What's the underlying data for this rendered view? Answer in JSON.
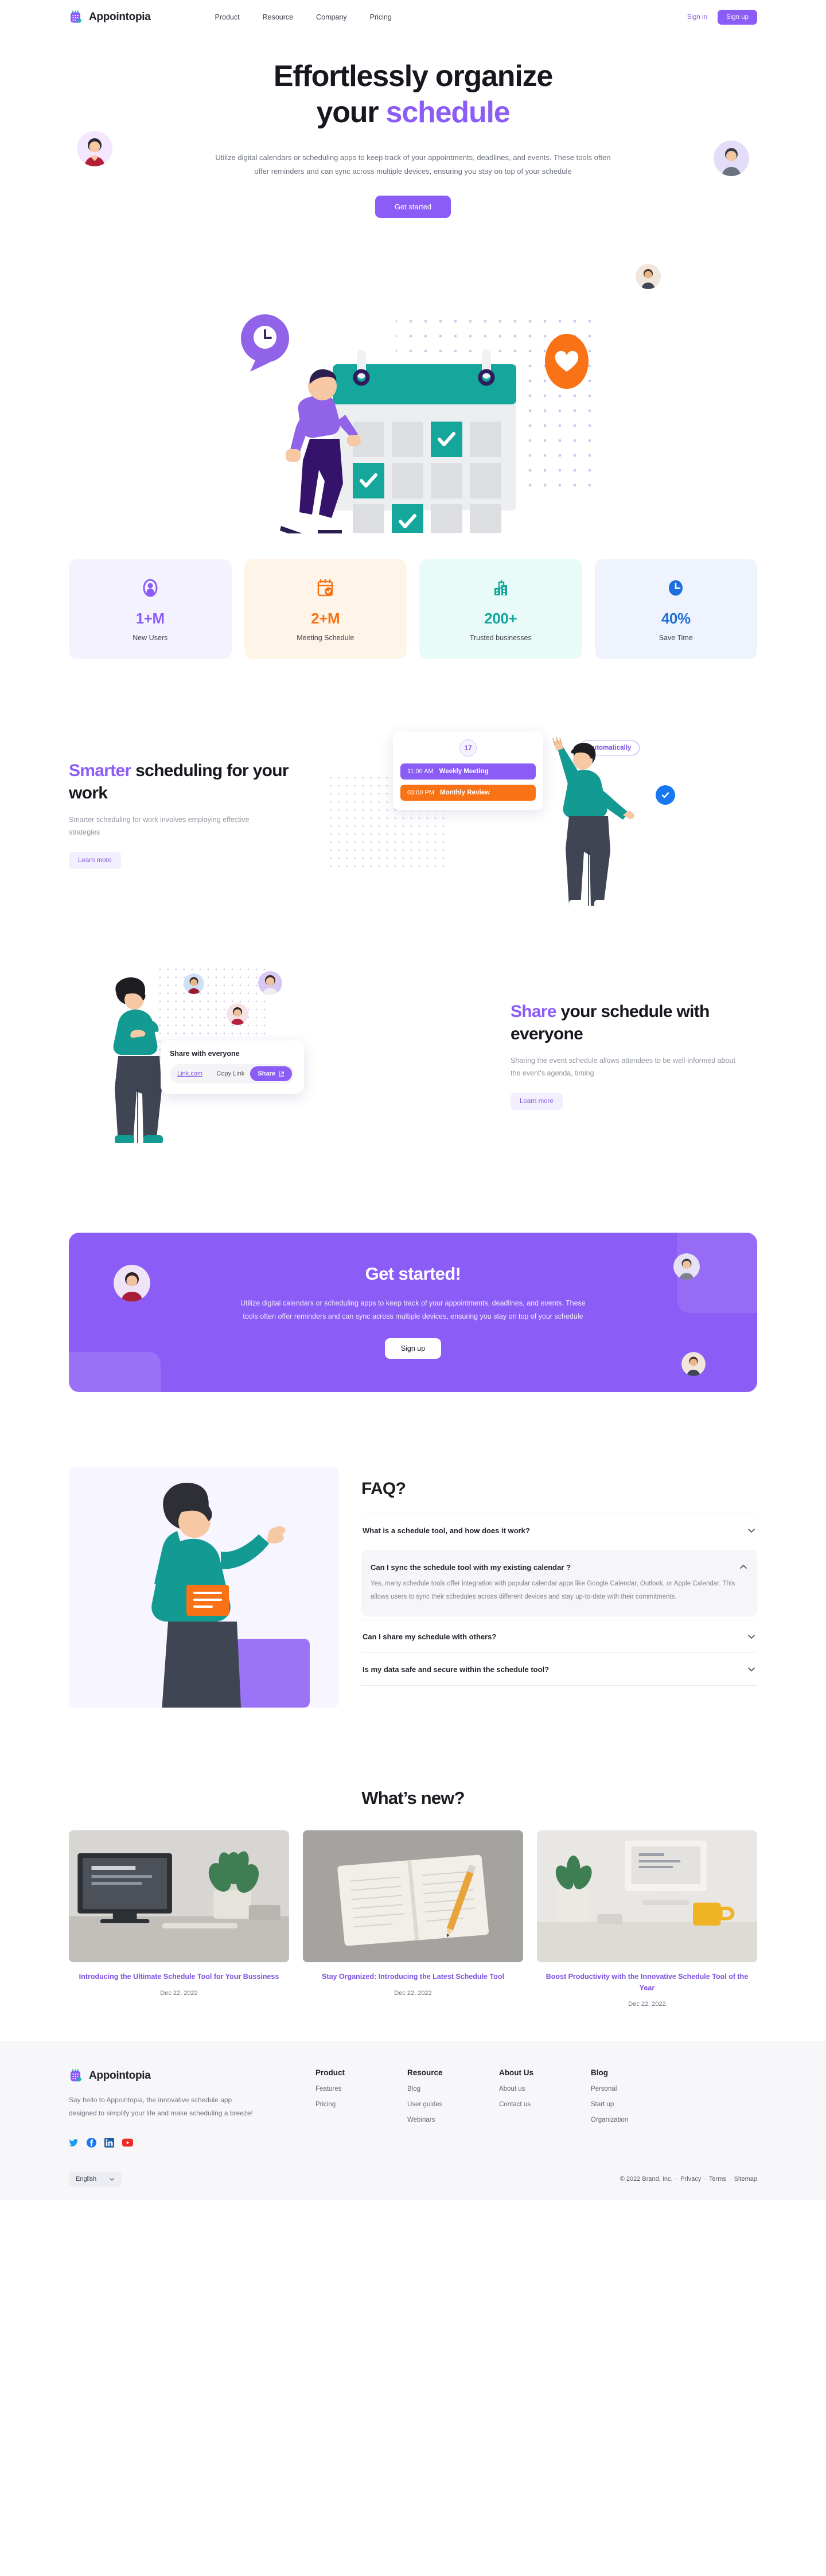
{
  "brand": {
    "name": "Appointopia",
    "logo_icon": "calendar-logo-icon"
  },
  "nav": {
    "links": [
      {
        "label": "Product"
      },
      {
        "label": "Resource"
      },
      {
        "label": "Company"
      },
      {
        "label": "Pricing"
      }
    ],
    "sign_in": "Sign in",
    "sign_up": "Sign up"
  },
  "hero": {
    "title_line1": "Effortlessly organize",
    "title_line2_plain": "your ",
    "title_line2_accent": "schedule",
    "subtitle": "Utilize digital calendars or scheduling apps to keep track of your appointments, deadlines, and events. These tools often offer reminders and can sync across multiple devices, ensuring you stay on top of your schedule",
    "cta_label": "Get started"
  },
  "stats": [
    {
      "icon": "user-avatar-icon",
      "value": "1+M",
      "label": "New Users",
      "bg": "#f5f2ff",
      "color": "#8b5cf6"
    },
    {
      "icon": "calendar-check-icon",
      "value": "2+M",
      "label": "Meeting Schedule",
      "bg": "#fff4e8",
      "color": "#f97316"
    },
    {
      "icon": "office-building-icon",
      "value": "200+",
      "label": "Trusted businesses",
      "bg": "#e9fbf8",
      "color": "#14a89d"
    },
    {
      "icon": "clock-icon",
      "value": "40%",
      "label": "Save Time",
      "bg": "#eef3fd",
      "color": "#1e6fd9"
    }
  ],
  "smarter": {
    "title_accent": "Smarter",
    "title_rest": " scheduling for your work",
    "body": "Smarter scheduling for work involves employing effective strategies",
    "cta_label": "Learn more",
    "card": {
      "day": "17",
      "events": [
        {
          "time": "11:00 AM",
          "title": "Weekly Meeting",
          "color": "#8b5cf6"
        },
        {
          "time": "03:00 PM",
          "title": "Monthly Review",
          "color": "#f97316"
        }
      ],
      "badge": "Automatically"
    }
  },
  "share": {
    "title_accent": "Share",
    "title_rest": " your schedule with everyone",
    "body": "Sharing the event schedule allows attendees to be well-informed about the event's agenda, timing",
    "cta_label": "Learn more",
    "card": {
      "heading": "Share with everyone",
      "link": "Link.com",
      "copy_label": "Copy Link",
      "share_label": "Share"
    }
  },
  "cta": {
    "title": "Get started!",
    "body": "Utilize digital calendars or scheduling apps to keep track of your appointments, deadlines, and events. These tools often offer reminders and can sync across multiple devices, ensuring you stay on top of your schedule",
    "button": "Sign up"
  },
  "faq": {
    "heading": "FAQ?",
    "items": [
      {
        "question": "What is a schedule tool, and how does it work?",
        "answer": "",
        "open": false
      },
      {
        "question": "Can I sync the schedule tool with my existing calendar ?",
        "answer": "Yes, many schedule tools offer integration with popular calendar apps like Google Calendar, Outlook, or Apple Calendar. This allows users to sync their schedules across different devices and stay up-to-date with their commitments.",
        "open": true
      },
      {
        "question": "Can I share my schedule with others?",
        "answer": "",
        "open": false
      },
      {
        "question": "Is my data safe and secure within the schedule tool?",
        "answer": "",
        "open": false
      }
    ]
  },
  "whats_new": {
    "heading": "What’s new?",
    "posts": [
      {
        "title": "Introducing the Ultimate Schedule Tool for Your Bussiness",
        "date": "Dec 22, 2022",
        "thumb": "desk-monitor-plant-photo"
      },
      {
        "title": "Stay Organized: Introducing the Latest Schedule Tool",
        "date": "Dec 22, 2022",
        "thumb": "open-notebook-pencil-photo"
      },
      {
        "title": "Boost Productivity with the Innovative Schedule Tool of the Year",
        "date": "Dec 22, 2022",
        "thumb": "white-desk-mug-photo"
      }
    ]
  },
  "footer": {
    "brand": "Appointopia",
    "description": "Say hello to Appointopia, the innovative schedule app designed to simplify your life and make scheduling a breeze!",
    "socials": [
      {
        "name": "twitter-icon",
        "color": "#1d9bf0"
      },
      {
        "name": "facebook-icon",
        "color": "#1877f2"
      },
      {
        "name": "linkedin-icon",
        "color": "#1d5fa8"
      },
      {
        "name": "youtube-icon",
        "color": "#ed2a26"
      }
    ],
    "columns": [
      {
        "heading": "Product",
        "links": [
          "Features",
          "Pricing"
        ]
      },
      {
        "heading": "Resource",
        "links": [
          "Blog",
          "User guides",
          "Webinars"
        ]
      },
      {
        "heading": "About Us",
        "links": [
          "About us",
          "Contact us"
        ]
      },
      {
        "heading": "Blog",
        "links": [
          "Personal",
          "Start up",
          "Organization"
        ]
      }
    ],
    "language": "English",
    "copyright": "© 2022 Brand, Inc.",
    "legal": [
      "Privacy",
      "Terms",
      "Sitemap"
    ]
  },
  "theme": {
    "purple": "#8b5cf6",
    "purple_dark": "#7c4fe0",
    "orange": "#f97316",
    "teal": "#14a89d",
    "blue": "#1877f2",
    "ink": "#17181f",
    "muted": "#6e7280"
  }
}
